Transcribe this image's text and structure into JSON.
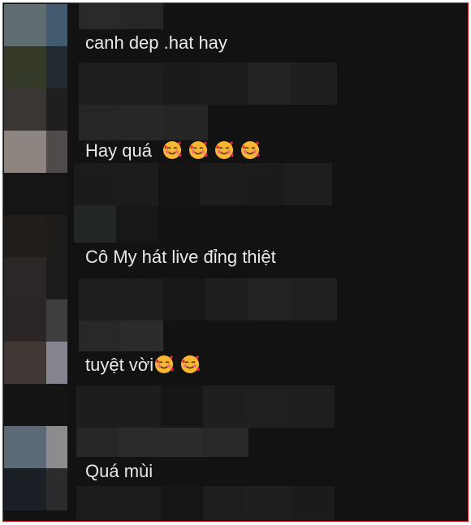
{
  "comments": [
    {
      "text": "canh dep .hat hay",
      "emojis": []
    },
    {
      "text": "Hay quá",
      "emojis": [
        "smiling-face-with-hearts-icon",
        "smiling-face-with-hearts-icon",
        "smiling-face-with-hearts-icon",
        "smiling-face-with-hearts-icon"
      ]
    },
    {
      "text": "Cô My hát live đỉng thiệt",
      "emojis": []
    },
    {
      "text": "tuyệt vời",
      "emojis": [
        "smiling-face-with-hearts-icon",
        "smiling-face-with-hearts-icon"
      ]
    },
    {
      "text": "Quá mùi",
      "emojis": []
    }
  ],
  "colors": {
    "background": "#121212",
    "text": "#e8e8e8",
    "border": "#d11a1a"
  }
}
